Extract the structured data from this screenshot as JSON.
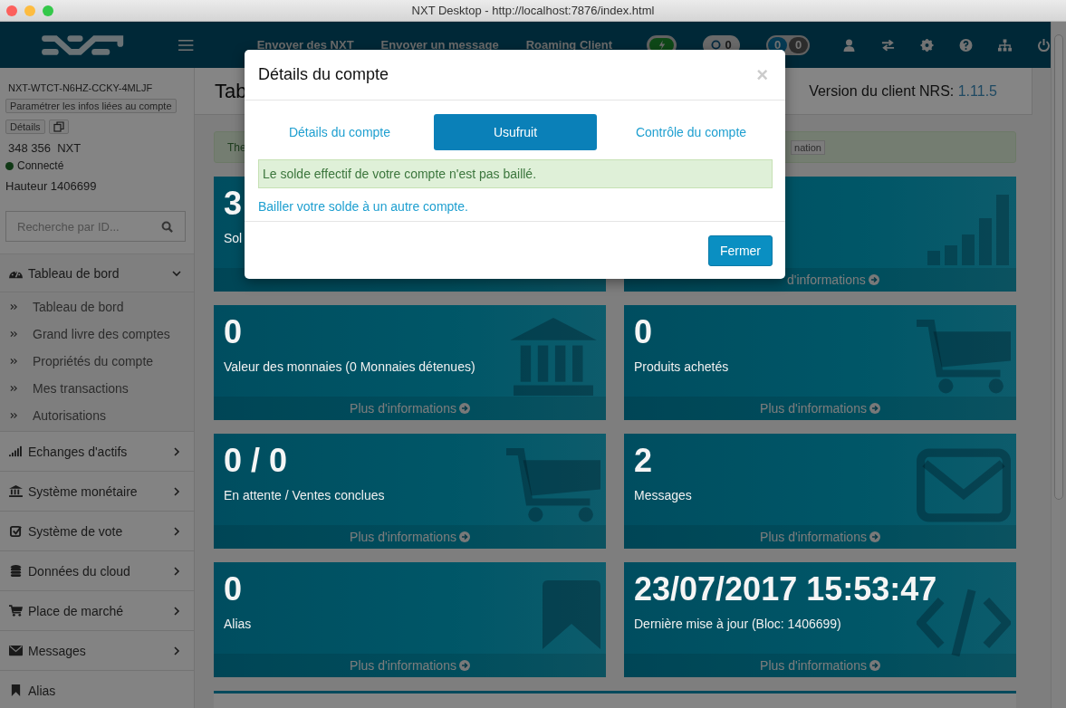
{
  "window": {
    "title": "NXT Desktop - http://localhost:7876/index.html"
  },
  "navbar": {
    "links": [
      "Envoyer des NXT",
      "Envoyer un message",
      "Roaming Client"
    ],
    "pending_count": "0",
    "unconfirmed_count": "0",
    "confirmed_count": "0"
  },
  "sidebar": {
    "account_id": "NXT-WTCT-N6HZ-CCKY-4MLJF",
    "set_info_button": "Paramétrer les infos liées au compte",
    "details_button": "Détails",
    "balance": "348 356  NXT",
    "status": "Connecté",
    "connected": true,
    "height": "Hauteur 1406699",
    "search": {
      "placeholder": "Recherche par ID..."
    },
    "menu": [
      {
        "label": "Tableau de bord",
        "kind": "group",
        "expanded": true,
        "children": [
          {
            "label": "Tableau de bord"
          },
          {
            "label": "Grand livre des comptes"
          },
          {
            "label": "Propriétés du compte"
          },
          {
            "label": "Mes transactions"
          },
          {
            "label": "Autorisations"
          }
        ]
      },
      {
        "label": "Echanges d'actifs",
        "kind": "group",
        "expanded": false
      },
      {
        "label": "Système monétaire",
        "kind": "group",
        "expanded": false
      },
      {
        "label": "Système de vote",
        "kind": "group",
        "expanded": false
      },
      {
        "label": "Données du cloud",
        "kind": "group",
        "expanded": false
      },
      {
        "label": "Place de marché",
        "kind": "group",
        "expanded": false
      },
      {
        "label": "Messages",
        "kind": "group",
        "expanded": false
      },
      {
        "label": "Alias",
        "kind": "link"
      }
    ]
  },
  "main": {
    "heading": "Tab",
    "version_label": "Version du client NRS:",
    "version": "1.11.5",
    "alert": "The",
    "alert_button": "nation",
    "cards": [
      {
        "value": "3",
        "label": "Sol"
      },
      {
        "footer": "d'informations"
      },
      {
        "value": "0",
        "label": "Valeur des monnaies (0 Monnaies détenues)",
        "footer": "Plus d'informations"
      },
      {
        "value": "0",
        "label": "Produits achetés",
        "footer": "Plus d'informations"
      },
      {
        "value": "0 / 0",
        "label": "En attente / Ventes conclues",
        "footer": "Plus d'informations"
      },
      {
        "value": "2",
        "label": "Messages",
        "footer": "Plus d'informations"
      },
      {
        "value": "0",
        "label": "Alias",
        "footer": "Plus d'informations"
      },
      {
        "value": "23/07/2017 15:53:47",
        "label": "Dernière mise à jour (Bloc: 1406699)",
        "footer": "Plus d'informations"
      }
    ]
  },
  "modal": {
    "title": "Détails du compte",
    "close": "×",
    "tabs": [
      {
        "label": "Détails du compte",
        "selected": false
      },
      {
        "label": "Usufruit",
        "selected": true
      },
      {
        "label": "Contrôle du compte",
        "selected": false
      }
    ],
    "notice": "Le solde effectif de votre compte n'est pas baillé.",
    "link": "Bailler votre solde à un autre compte.",
    "close_button": "Fermer"
  }
}
